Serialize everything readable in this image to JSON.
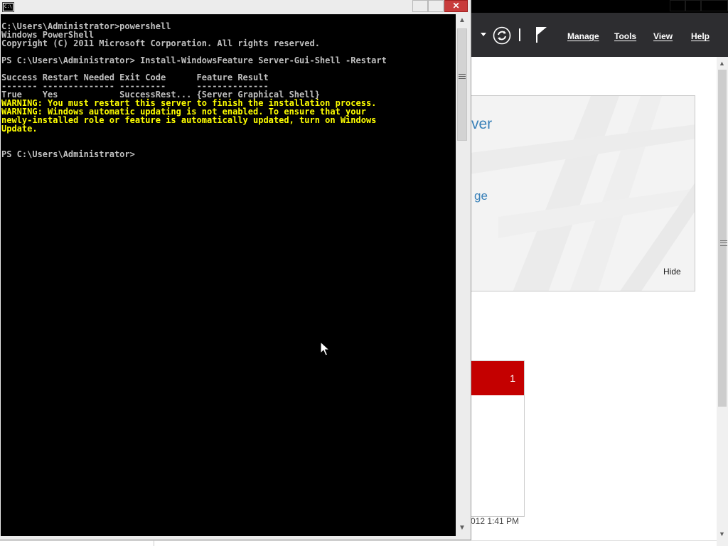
{
  "console_window": {
    "title": "",
    "icon_text": "C:\\.",
    "close_glyph": "✕",
    "lines": [
      {
        "text": "C:\\Users\\Administrator>powershell",
        "style": "norm"
      },
      {
        "text": "Windows PowerShell",
        "style": "norm"
      },
      {
        "text": "Copyright (C) 2011 Microsoft Corporation. All rights reserved.",
        "style": "norm"
      },
      {
        "text": "",
        "style": "norm"
      },
      {
        "text": "PS C:\\Users\\Administrator> Install-WindowsFeature Server-Gui-Shell -Restart",
        "style": "norm"
      },
      {
        "text": "",
        "style": "norm"
      },
      {
        "text": "Success Restart Needed Exit Code      Feature Result",
        "style": "norm"
      },
      {
        "text": "------- -------------- ---------      --------------",
        "style": "norm"
      },
      {
        "text": "True    Yes            SuccessRest... {Server Graphical Shell}",
        "style": "norm"
      },
      {
        "text": "WARNING: You must restart this server to finish the installation process.",
        "style": "warn"
      },
      {
        "text": "WARNING: Windows automatic updating is not enabled. To ensure that your",
        "style": "warn"
      },
      {
        "text": "newly-installed role or feature is automatically updated, turn on Windows",
        "style": "warn"
      },
      {
        "text": "Update.",
        "style": "warn"
      },
      {
        "text": "",
        "style": "norm"
      },
      {
        "text": "",
        "style": "norm"
      },
      {
        "text": "PS C:\\Users\\Administrator>",
        "style": "norm"
      }
    ],
    "scrollbar": {
      "up_glyph": "▲",
      "down_glyph": "▼"
    }
  },
  "server_manager": {
    "toolbar": {
      "manage_label": "Manage",
      "tools_label": "Tools",
      "view_label": "View",
      "help_label": "Help"
    },
    "welcome_tile": {
      "title_fragment": "ver",
      "link_fragment": "ge",
      "hide_label": "Hide"
    },
    "status_tile": {
      "count": "1"
    },
    "timestamp_fragment": "012 1:41 PM",
    "scrollbar": {
      "up_glyph": "▲",
      "down_glyph": "▼"
    }
  },
  "colors": {
    "console_bg": "#000000",
    "console_text": "#c0c0c0",
    "warning_text": "#ffff00",
    "toolbar_bg": "#2d2d30",
    "alert_red": "#c40000",
    "link_blue": "#3880b8"
  },
  "icons": {
    "refresh": "refresh-icon",
    "flag": "notifications-flag-icon",
    "cursor": "mouse-pointer-icon"
  }
}
